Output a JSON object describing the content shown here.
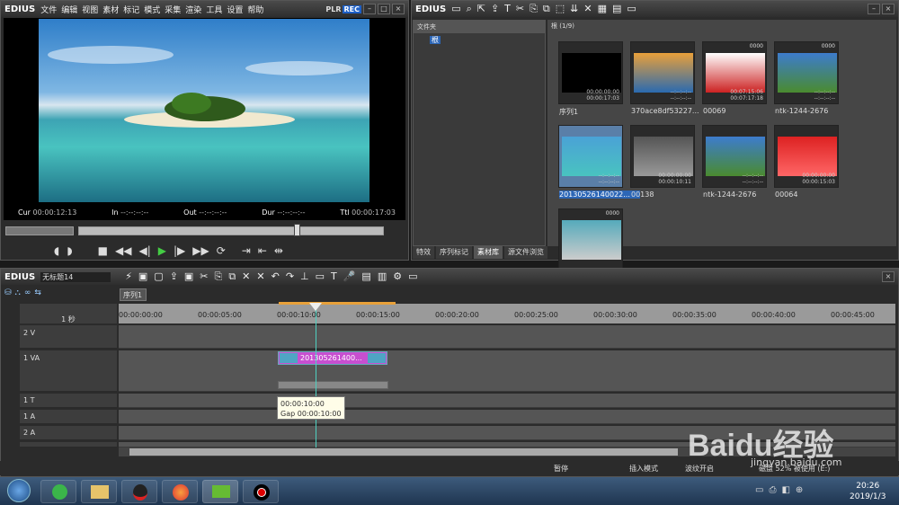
{
  "player": {
    "logo": "EDIUS",
    "menu": [
      "文件",
      "编辑",
      "视图",
      "素材",
      "标记",
      "模式",
      "采集",
      "渲染",
      "工具",
      "设置",
      "帮助"
    ],
    "plr": "PLR",
    "rec": "REC",
    "cur_label": "Cur",
    "cur": "00:00:12:13",
    "in_label": "In",
    "in": "--:--:--:--",
    "out_label": "Out",
    "out": "--:--:--:--",
    "dur_label": "Dur",
    "dur": "--:--:--:--",
    "ttl_label": "Ttl",
    "ttl": "00:00:17:03"
  },
  "bin": {
    "logo": "EDIUS",
    "folder_header": "文件夹",
    "root": "根",
    "path": "根 (1/9)",
    "tabs": [
      "特效",
      "序列标记",
      "素材库",
      "源文件浏览"
    ],
    "clips": [
      {
        "label": "序列1",
        "tc1": "00:00:00:00",
        "tc2": "00:00:17:03",
        "top": ""
      },
      {
        "label": "370ace8df53227...",
        "tc1": "--:--:--:--",
        "tc2": "--:--:--:--",
        "top": ""
      },
      {
        "label": "00069",
        "tc1": "00:07:15:06",
        "tc2": "00:07:17:18",
        "top": "0000"
      },
      {
        "label": "ntk-1244-2676",
        "tc1": "--:--:--:--",
        "tc2": "--:--:--:--",
        "top": "0000"
      },
      {
        "label": "20130526140022...",
        "tc1": "--:--:--:--",
        "tc2": "--:--:--:--",
        "top": ""
      },
      {
        "label": "00138",
        "tc1": "00:00:00:00",
        "tc2": "00:00:10:11",
        "top": ""
      },
      {
        "label": "ntk-1244-2676",
        "tc1": "--:--:--:--",
        "tc2": "--:--:--:--",
        "top": ""
      },
      {
        "label": "00064",
        "tc1": "00:00:00:00",
        "tc2": "00:00:15:03",
        "top": ""
      },
      {
        "label": "",
        "tc1": "",
        "tc2": "",
        "top": "0000"
      }
    ]
  },
  "timeline": {
    "logo": "EDIUS",
    "project": "无标题14",
    "sequence_tab": "序列1",
    "scale": "1 秒",
    "ruler": [
      "00:00:00:00",
      "00:00:05:00",
      "00:00:10:00",
      "00:00:15:00",
      "00:00:20:00",
      "00:00:25:00",
      "00:00:30:00",
      "00:00:35:00",
      "00:00:40:00",
      "00:00:45:00"
    ],
    "tracks": [
      "2 V",
      "1 VA",
      "1 T",
      "1 A",
      "2 A",
      "3 A"
    ],
    "clip_label": "201305261400...",
    "tooltip_line1": "00:00:10:00",
    "tooltip_line2": "Gap 00:00:10:00",
    "status_pause": "暂停",
    "status_insert": "插入模式",
    "status_ripple": "波纹开启",
    "status_disk": "磁盘 52% 被使用 (E:)"
  },
  "taskbar": {
    "time": "20:26",
    "date": "2019/1/3"
  },
  "watermark": "Baidu经验",
  "watermark_url": "jingyan.baidu.com"
}
